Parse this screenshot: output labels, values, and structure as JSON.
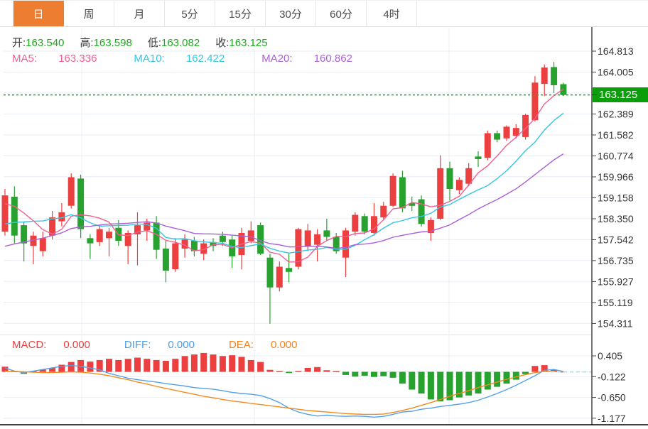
{
  "tabs": [
    {
      "label": "日",
      "active": true
    },
    {
      "label": "周",
      "active": false
    },
    {
      "label": "月",
      "active": false
    },
    {
      "label": "5分",
      "active": false
    },
    {
      "label": "15分",
      "active": false
    },
    {
      "label": "30分",
      "active": false
    },
    {
      "label": "60分",
      "active": false
    },
    {
      "label": "4时",
      "active": false
    }
  ],
  "header": {
    "open_label": "开:",
    "open": "163.540",
    "high_label": "高:",
    "high": "163.598",
    "low_label": "低:",
    "low": "163.082",
    "close_label": "收:",
    "close": "163.125",
    "ma5_label": "MA5: ",
    "ma5": "163.336",
    "ma10_label": "MA10: ",
    "ma10": "162.422",
    "ma20_label": "MA20: ",
    "ma20": "160.862"
  },
  "macd_header": {
    "macd_label": "MACD:",
    "macd": "0.000",
    "diff_label": "DIFF:",
    "diff": "0.000",
    "dea_label": "DEA:",
    "dea": "0.000"
  },
  "price_marker": {
    "value": "163.125"
  },
  "colors": {
    "up": "#ec3f3f",
    "down": "#27a22e",
    "ma5": "#f2608f",
    "ma10": "#35c6e3",
    "ma20": "#ab60d5",
    "diff": "#55a0e8",
    "dea": "#f28a1e",
    "tab_accent": "#ed7d31",
    "price_label_bg": "#0a9e0a",
    "price_line": "#0db30d",
    "grid": "#e8eef6",
    "axis": "#3a3a3a",
    "tick_text": "#333333",
    "zero_dash": "#d9e3ed",
    "right_dash": "#b9e2f2",
    "macd_text": "#e84040",
    "diff_text": "#4d9ce0",
    "dea_text": "#f5821e",
    "ohlc_value": "#1fa81f"
  },
  "chart_data": [
    {
      "type": "candlestick",
      "title": "Daily candlestick panel",
      "y_ticks": [
        "164.813",
        "164.005",
        "162.389",
        "161.582",
        "160.774",
        "159.966",
        "159.158",
        "158.350",
        "157.542",
        "156.735",
        "155.927",
        "155.119",
        "154.311"
      ],
      "ylim": [
        154.311,
        164.813
      ],
      "current_price": 163.125,
      "grid": true,
      "legend_position": "top-left",
      "candles": [
        [
          157.85,
          159.5,
          157.7,
          159.25
        ],
        [
          159.2,
          159.6,
          157.4,
          157.7
        ],
        [
          158.1,
          158.25,
          156.7,
          157.4
        ],
        [
          157.3,
          157.85,
          156.6,
          157.7
        ],
        [
          157.1,
          157.85,
          156.9,
          157.6
        ],
        [
          157.7,
          158.65,
          157.55,
          158.4
        ],
        [
          158.25,
          158.95,
          158.05,
          158.6
        ],
        [
          158.85,
          160.1,
          158.75,
          159.95
        ],
        [
          159.9,
          160.05,
          157.6,
          157.95
        ],
        [
          157.6,
          157.75,
          156.8,
          157.4
        ],
        [
          157.45,
          158.1,
          157.3,
          157.95
        ],
        [
          157.6,
          158.0,
          156.9,
          157.85
        ],
        [
          158.0,
          158.3,
          157.3,
          157.5
        ],
        [
          157.3,
          157.9,
          156.6,
          157.8
        ],
        [
          157.75,
          158.6,
          156.55,
          158.1
        ],
        [
          157.9,
          158.35,
          157.5,
          158.2
        ],
        [
          158.2,
          158.45,
          156.8,
          157.15
        ],
        [
          157.2,
          157.5,
          155.9,
          156.35
        ],
        [
          156.4,
          157.6,
          156.3,
          157.4
        ],
        [
          157.2,
          157.75,
          156.85,
          157.55
        ],
        [
          157.5,
          157.65,
          156.9,
          157.1
        ],
        [
          157.0,
          157.55,
          156.75,
          157.4
        ],
        [
          157.45,
          157.6,
          157.1,
          157.3
        ],
        [
          157.7,
          157.85,
          157.3,
          157.45
        ],
        [
          157.55,
          157.7,
          156.45,
          156.9
        ],
        [
          156.95,
          158.0,
          156.4,
          157.8
        ],
        [
          157.5,
          158.25,
          157.4,
          157.9
        ],
        [
          158.1,
          158.2,
          156.95,
          157.0
        ],
        [
          156.85,
          157.0,
          154.3,
          155.7
        ],
        [
          155.7,
          156.7,
          155.55,
          156.5
        ],
        [
          156.45,
          157.0,
          155.9,
          156.3
        ],
        [
          156.5,
          158.0,
          156.4,
          157.95
        ],
        [
          157.3,
          158.15,
          157.1,
          157.9
        ],
        [
          157.35,
          157.95,
          156.7,
          157.75
        ],
        [
          157.9,
          158.35,
          157.5,
          157.65
        ],
        [
          157.65,
          157.8,
          157.0,
          157.1
        ],
        [
          156.85,
          158.0,
          156.1,
          157.9
        ],
        [
          157.85,
          158.6,
          157.7,
          158.5
        ],
        [
          158.45,
          158.55,
          157.75,
          157.85
        ],
        [
          157.8,
          158.95,
          157.7,
          158.45
        ],
        [
          158.4,
          159.0,
          158.3,
          158.85
        ],
        [
          158.85,
          160.1,
          158.8,
          160.0
        ],
        [
          159.95,
          160.2,
          158.6,
          158.75
        ],
        [
          158.95,
          159.2,
          158.65,
          158.85
        ],
        [
          159.1,
          159.25,
          158.05,
          158.15
        ],
        [
          157.8,
          158.4,
          157.5,
          158.3
        ],
        [
          158.35,
          160.8,
          158.3,
          160.3
        ],
        [
          160.3,
          160.55,
          159.05,
          159.5
        ],
        [
          159.45,
          159.95,
          159.3,
          159.85
        ],
        [
          159.7,
          160.5,
          159.6,
          160.3
        ],
        [
          160.75,
          160.95,
          160.35,
          160.65
        ],
        [
          160.7,
          161.75,
          160.6,
          161.65
        ],
        [
          161.65,
          161.75,
          161.3,
          161.4
        ],
        [
          161.45,
          161.95,
          161.35,
          161.9
        ],
        [
          161.55,
          162.0,
          161.45,
          161.85
        ],
        [
          161.5,
          162.4,
          161.4,
          162.35
        ],
        [
          162.15,
          163.85,
          162.1,
          163.6
        ],
        [
          163.55,
          164.3,
          163.08,
          164.18
        ],
        [
          164.2,
          164.4,
          163.2,
          163.5
        ],
        [
          163.54,
          163.598,
          163.082,
          163.125
        ]
      ],
      "prehistory_closes": [
        155.9,
        156.0,
        156.1,
        156.2,
        156.35,
        156.5,
        156.6,
        156.75,
        156.9,
        157.0,
        157.1,
        157.25,
        157.4,
        157.5,
        157.6,
        158.2,
        158.7,
        159.2,
        159.3
      ],
      "ma_lines": [
        {
          "name": "MA5",
          "period": 5,
          "last": "163.336"
        },
        {
          "name": "MA10",
          "period": 10,
          "last": "162.422"
        },
        {
          "name": "MA20",
          "period": 20,
          "last": "160.862"
        }
      ]
    },
    {
      "type": "bar",
      "title": "MACD panel",
      "y_ticks": [
        "0.405",
        "-0.122",
        "-0.650",
        "-1.177"
      ],
      "ylim": [
        -1.177,
        0.405
      ],
      "values": [
        0.13,
        0.02,
        -0.05,
        0.02,
        0.06,
        0.1,
        0.18,
        0.25,
        0.3,
        0.26,
        0.3,
        0.33,
        0.3,
        0.33,
        0.36,
        0.33,
        0.3,
        0.28,
        0.33,
        0.4,
        0.44,
        0.48,
        0.44,
        0.4,
        0.42,
        0.38,
        0.3,
        0.25,
        0.05,
        0.02,
        -0.03,
        0.02,
        0.1,
        0.12,
        0.04,
        0.02,
        -0.08,
        -0.12,
        -0.1,
        -0.13,
        -0.11,
        -0.15,
        -0.3,
        -0.45,
        -0.55,
        -0.7,
        -0.75,
        -0.72,
        -0.65,
        -0.6,
        -0.55,
        -0.45,
        -0.38,
        -0.3,
        -0.2,
        -0.06,
        0.15,
        0.17,
        0.05,
        0.01
      ],
      "series": [
        {
          "name": "DIFF",
          "values": [
            0.1,
            0.02,
            -0.02,
            0.02,
            0.06,
            0.1,
            0.14,
            0.16,
            0.14,
            0.1,
            0.05,
            -0.04,
            -0.1,
            -0.16,
            -0.2,
            -0.23,
            -0.26,
            -0.3,
            -0.33,
            -0.36,
            -0.4,
            -0.42,
            -0.44,
            -0.48,
            -0.52,
            -0.55,
            -0.57,
            -0.6,
            -0.68,
            -0.78,
            -0.92,
            -1.02,
            -1.08,
            -1.12,
            -1.1,
            -1.12,
            -1.13,
            -1.12,
            -1.13,
            -1.15,
            -1.13,
            -1.08,
            -1.02,
            -1.0,
            -0.95,
            -0.92,
            -0.88,
            -0.85,
            -0.82,
            -0.78,
            -0.72,
            -0.64,
            -0.55,
            -0.45,
            -0.34,
            -0.22,
            -0.1,
            0.04,
            0.06,
            0.01
          ]
        },
        {
          "name": "DEA",
          "values": [
            0.02,
            0.01,
            0.0,
            -0.01,
            -0.02,
            -0.02,
            -0.01,
            0.0,
            -0.01,
            -0.03,
            -0.06,
            -0.1,
            -0.15,
            -0.2,
            -0.26,
            -0.31,
            -0.37,
            -0.42,
            -0.47,
            -0.52,
            -0.57,
            -0.62,
            -0.66,
            -0.7,
            -0.74,
            -0.77,
            -0.8,
            -0.83,
            -0.86,
            -0.89,
            -0.92,
            -0.95,
            -0.98,
            -1.0,
            -1.02,
            -1.04,
            -1.06,
            -1.07,
            -1.08,
            -1.08,
            -1.07,
            -1.03,
            -0.98,
            -0.92,
            -0.85,
            -0.78,
            -0.7,
            -0.62,
            -0.55,
            -0.48,
            -0.4,
            -0.33,
            -0.26,
            -0.19,
            -0.13,
            -0.07,
            -0.02,
            0.01,
            0.01,
            0.0
          ]
        }
      ]
    }
  ]
}
